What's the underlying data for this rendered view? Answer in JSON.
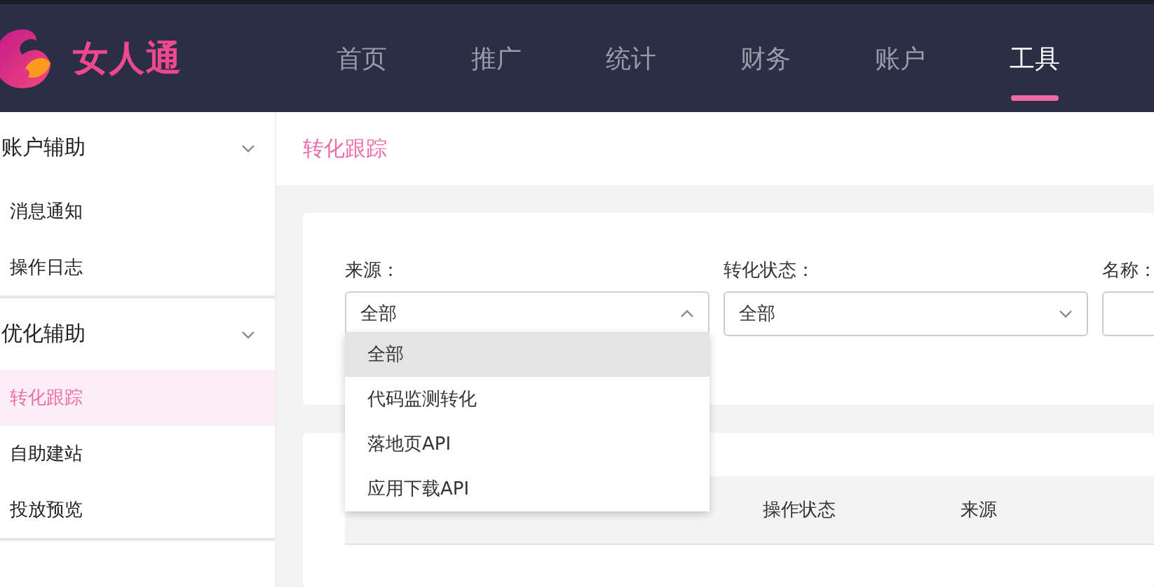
{
  "brand": {
    "name": "女人通"
  },
  "nav": [
    {
      "label": "首页",
      "selected": false
    },
    {
      "label": "推广",
      "selected": false
    },
    {
      "label": "统计",
      "selected": false
    },
    {
      "label": "财务",
      "selected": false
    },
    {
      "label": "账户",
      "selected": false
    },
    {
      "label": "工具",
      "selected": true
    }
  ],
  "sidebar": {
    "groups": [
      {
        "title": "账户辅助",
        "expanded": true,
        "items": [
          {
            "label": "消息通知",
            "selected": false
          },
          {
            "label": "操作日志",
            "selected": false
          }
        ]
      },
      {
        "title": "优化辅助",
        "expanded": true,
        "items": [
          {
            "label": "转化跟踪",
            "selected": true
          },
          {
            "label": "自助建站",
            "selected": false
          },
          {
            "label": "投放预览",
            "selected": false
          }
        ]
      }
    ]
  },
  "breadcrumb": "转化跟踪",
  "filters": [
    {
      "label": "来源：",
      "kind": "select",
      "value": "全部",
      "open": true
    },
    {
      "label": "转化状态：",
      "kind": "select",
      "value": "全部",
      "open": false
    },
    {
      "label": "名称：",
      "kind": "input"
    }
  ],
  "dropdown": {
    "options": [
      {
        "label": "全部",
        "selected": true
      },
      {
        "label": "代码监测转化",
        "selected": false
      },
      {
        "label": "落地页API",
        "selected": false
      },
      {
        "label": "应用下载API",
        "selected": false
      }
    ]
  },
  "table": {
    "columns": [
      "",
      "",
      "操作状态",
      "来源"
    ]
  }
}
